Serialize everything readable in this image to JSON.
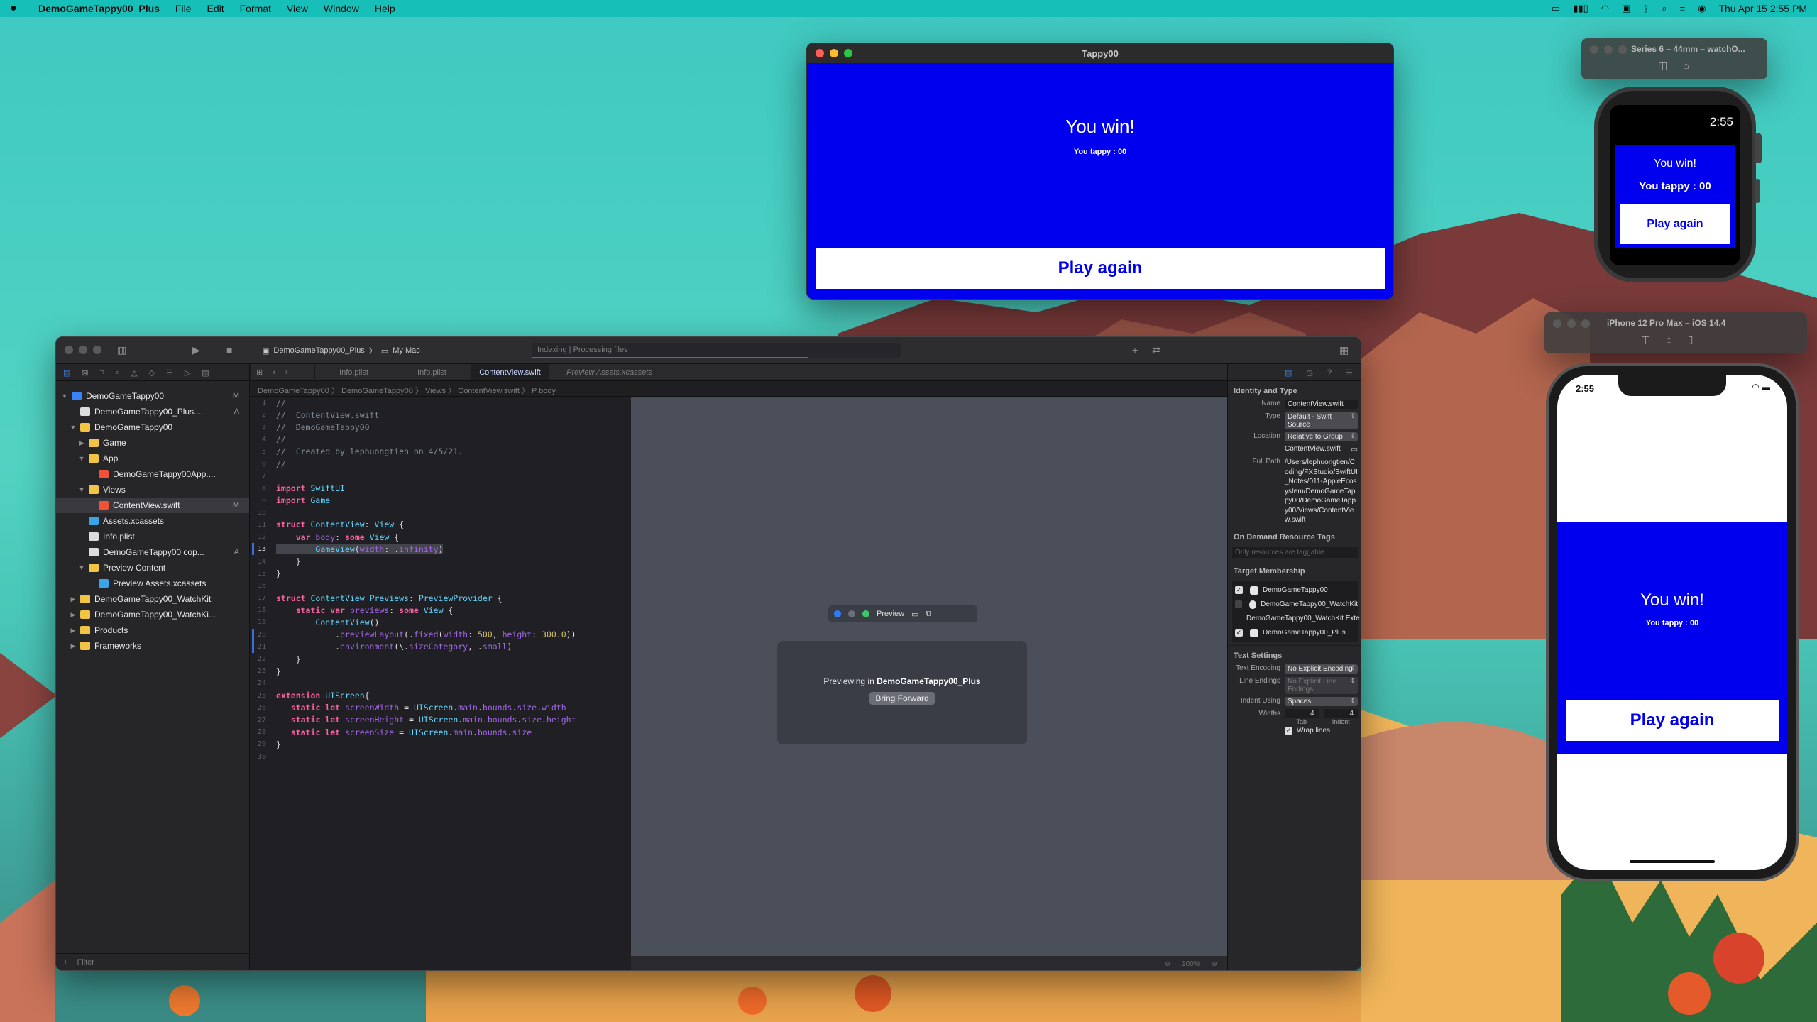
{
  "menubar": {
    "app_name": "DemoGameTappy00_Plus",
    "menus": [
      "File",
      "Edit",
      "Format",
      "View",
      "Window",
      "Help"
    ],
    "datetime": "Thu Apr 15  2:55 PM"
  },
  "tappy_window": {
    "title": "Tappy00",
    "win_text": "You win!",
    "tappy_text": "You tappy : 00",
    "button_label": "Play again"
  },
  "watch_sim": {
    "title": "Series 6 – 44mm – watchO...",
    "time": "2:55",
    "win_text": "You win!",
    "tappy_text": "You tappy : 00",
    "button_label": "Play again"
  },
  "iphone_sim": {
    "title": "iPhone 12 Pro Max – iOS 14.4",
    "time": "2:55",
    "win_text": "You win!",
    "tappy_text": "You tappy : 00",
    "button_label": "Play again"
  },
  "xcode": {
    "scheme": "DemoGameTappy00_Plus",
    "destination": "My Mac",
    "activity": "Indexing | Processing files",
    "tabs": [
      "Info.plist",
      "Info.plist",
      "ContentView.swift",
      "Preview Assets.xcassets"
    ],
    "jumpbar": "DemoGameTappy00  〉  DemoGameTappy00  〉  Views  〉  ContentView.swift  〉  P  body",
    "navigator": {
      "rows": [
        {
          "label": "DemoGameTappy00",
          "badge": "M"
        },
        {
          "label": "DemoGameTappy00_Plus....",
          "badge": "A"
        },
        {
          "label": "DemoGameTappy00",
          "badge": ""
        },
        {
          "label": "Game",
          "badge": ""
        },
        {
          "label": "App",
          "badge": ""
        },
        {
          "label": "DemoGameTappy00App....",
          "badge": ""
        },
        {
          "label": "Views",
          "badge": ""
        },
        {
          "label": "ContentView.swift",
          "badge": "M"
        },
        {
          "label": "Assets.xcassets",
          "badge": ""
        },
        {
          "label": "Info.plist",
          "badge": ""
        },
        {
          "label": "DemoGameTappy00 cop...",
          "badge": "A"
        },
        {
          "label": "Preview Content",
          "badge": ""
        },
        {
          "label": "Preview Assets.xcassets",
          "badge": ""
        },
        {
          "label": "DemoGameTappy00_WatchKit",
          "badge": ""
        },
        {
          "label": "DemoGameTappy00_WatchKi...",
          "badge": ""
        },
        {
          "label": "Products",
          "badge": ""
        },
        {
          "label": "Frameworks",
          "badge": ""
        }
      ],
      "filter_placeholder": "Filter"
    },
    "code_lines": [
      "//",
      "//  ContentView.swift",
      "//  DemoGameTappy00",
      "//",
      "//  Created by lephuongtien on 4/5/21.",
      "//",
      "",
      "import SwiftUI",
      "import Game",
      "",
      "struct ContentView: View {",
      "    var body: some View {",
      "        GameView(width: .infinity)",
      "    }",
      "}",
      "",
      "struct ContentView_Previews: PreviewProvider {",
      "    static var previews: some View {",
      "        ContentView()",
      "            .previewLayout(.fixed(width: 500, height: 300.0))",
      "            .environment(\\.sizeCategory, .small)",
      "    }",
      "}",
      "",
      "extension UIScreen{",
      "   static let screenWidth = UIScreen.main.bounds.size.width",
      "   static let screenHeight = UIScreen.main.bounds.size.height",
      "   static let screenSize = UIScreen.main.bounds.size",
      "}",
      ""
    ],
    "canvas": {
      "preview_label": "Preview",
      "previewing_prefix": "Previewing in ",
      "previewing_target": "DemoGameTappy00_Plus",
      "bring_forward": "Bring Forward",
      "zoom": "100%"
    },
    "inspector": {
      "identity_title": "Identity and Type",
      "name_label": "Name",
      "name_value": "ContentView.swift",
      "type_label": "Type",
      "type_value": "Default - Swift Source",
      "location_label": "Location",
      "location_value": "Relative to Group",
      "location_file": "ContentView.swift",
      "fullpath_label": "Full Path",
      "fullpath_value": "/Users/lephuongtien/Coding/FXStudio/SwiftUI_Notes/011-AppleEcosystem/DemoGameTappy00/DemoGameTappy00/Views/ContentView.swift",
      "odr_title": "On Demand Resource Tags",
      "odr_placeholder": "Only resources are taggable",
      "target_title": "Target Membership",
      "targets": [
        {
          "label": "DemoGameTappy00",
          "checked": true
        },
        {
          "label": "DemoGameTappy00_WatchKit",
          "checked": false
        },
        {
          "label": "DemoGameTappy00_WatchKit Exte...",
          "checked": false
        },
        {
          "label": "DemoGameTappy00_Plus",
          "checked": true
        }
      ],
      "text_title": "Text Settings",
      "encoding_label": "Text Encoding",
      "encoding_value": "No Explicit Encoding",
      "endings_label": "Line Endings",
      "endings_value": "No Explicit Line Endings",
      "indent_label": "Indent Using",
      "indent_value": "Spaces",
      "widths_label": "Widths",
      "tab_width": "4",
      "indent_width": "4",
      "tab_label": "Tab",
      "indent_label2": "Indent",
      "wrap_label": "Wrap lines"
    }
  },
  "colors": {
    "game_blue": "#0000ee",
    "desktop_teal": "#4fd0c4"
  }
}
